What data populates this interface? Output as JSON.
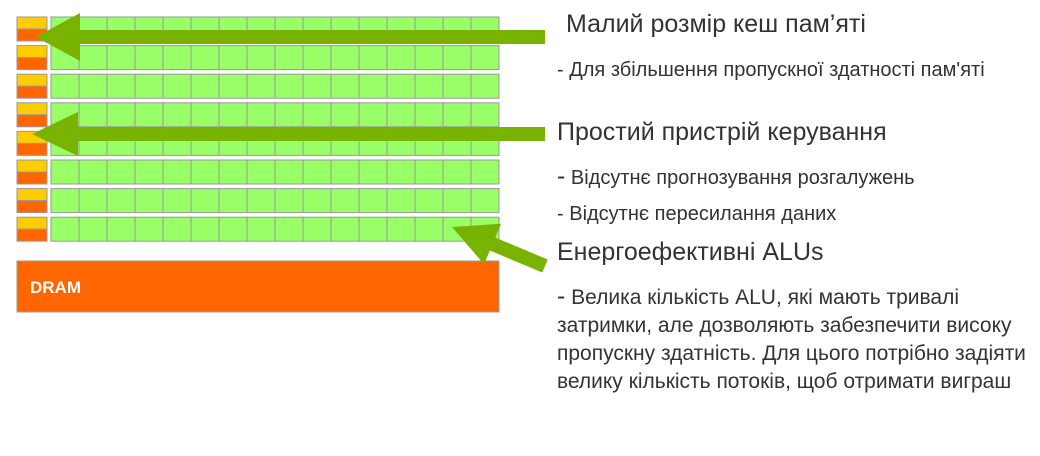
{
  "colors": {
    "alu_fill": "#99ff66",
    "grid_line": "#999999",
    "cache": "#ffcc00",
    "control": "#ff6600",
    "dram": "#ff6600",
    "arrow": "#77b300",
    "text": "#333333"
  },
  "dram": {
    "label": "DRAM"
  },
  "annotations": {
    "cache": {
      "heading": "Малий розмір кеш пам’яті",
      "details": [
        "- Для збільшення пропускної здатності пам'яті"
      ]
    },
    "control": {
      "heading": "Простий пристрій керування",
      "details": [
        {
          "dash": "-",
          "text": " Відсутнє прогнозування розгалужень"
        },
        {
          "dash": "-",
          "text": " Відсутнє пересилання даних"
        }
      ]
    },
    "alus": {
      "heading": "Енергоефективні ALUs",
      "details": [
        {
          "dash": "-",
          "text": " Велика кількість ALU, які мають тривалі затримки, але дозволяють забезпечити високу пропускну здатність. Для цього потрібно задіяти велику кількість потоків, щоб отримати виграш"
        }
      ]
    }
  }
}
